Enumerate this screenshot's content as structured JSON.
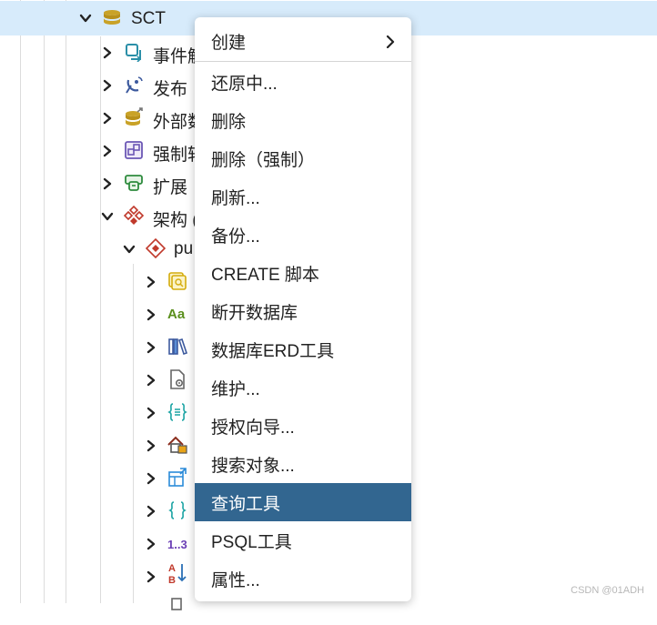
{
  "tree": {
    "root": {
      "label": "SCT"
    },
    "items": [
      {
        "label": "事件触"
      },
      {
        "label": "发布"
      },
      {
        "label": "外部数"
      },
      {
        "label": "强制转"
      },
      {
        "label": "扩展"
      },
      {
        "label": "架构 ("
      }
    ],
    "schema": {
      "label": "pu"
    },
    "collation_icon_text": "Aa",
    "sequence_icon_text": "1..3",
    "sort_icon_text": "A B"
  },
  "context_menu": {
    "items": [
      {
        "label": "创建",
        "has_submenu": true
      },
      {
        "label": "还原中..."
      },
      {
        "label": "删除"
      },
      {
        "label": "删除（强制）"
      },
      {
        "label": "刷新..."
      },
      {
        "label": "备份..."
      },
      {
        "label": "CREATE 脚本"
      },
      {
        "label": "断开数据库"
      },
      {
        "label": "数据库ERD工具"
      },
      {
        "label": "维护..."
      },
      {
        "label": "授权向导..."
      },
      {
        "label": "搜索对象..."
      },
      {
        "label": "查询工具",
        "highlighted": true
      },
      {
        "label": "PSQL工具"
      },
      {
        "label": "属性..."
      }
    ]
  },
  "watermark": "CSDN @01ADH",
  "colors": {
    "selected_row": "#d7ebfb",
    "menu_highlight": "#326690"
  }
}
